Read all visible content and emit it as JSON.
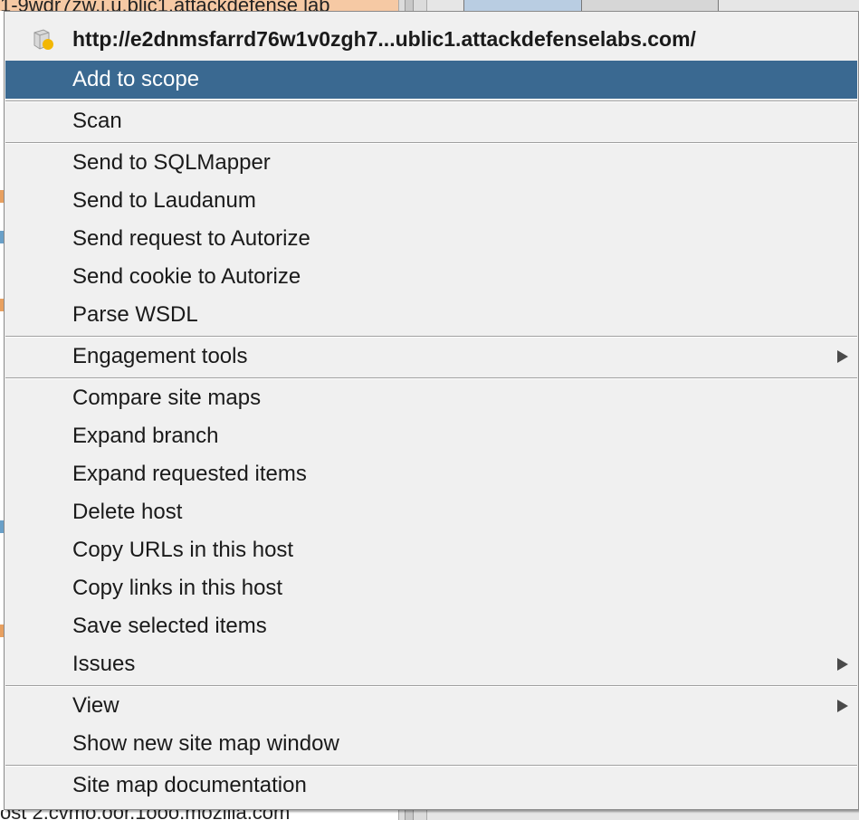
{
  "background": {
    "top_text": "1-9wdr7zw.i.u.blic1.attackdefense lab",
    "bottom_text": "ost 2.cvmo.oor.1ooo.mozilla.com"
  },
  "context_menu": {
    "header": {
      "icon": "host-node-icon",
      "url": "http://e2dnmsfarrd76w1v0zgh7...ublic1.attackdefenselabs.com/"
    },
    "items": [
      {
        "label": "Add to scope"
      },
      {
        "label": "Scan"
      },
      {
        "label": "Send to SQLMapper"
      },
      {
        "label": "Send to Laudanum"
      },
      {
        "label": "Send request to Autorize"
      },
      {
        "label": "Send cookie to Autorize"
      },
      {
        "label": "Parse WSDL"
      },
      {
        "label": "Engagement tools",
        "submenu_icon": "chevron-right-icon"
      },
      {
        "label": "Compare site maps"
      },
      {
        "label": "Expand branch"
      },
      {
        "label": "Expand requested items"
      },
      {
        "label": "Delete host"
      },
      {
        "label": "Copy URLs in this host"
      },
      {
        "label": "Copy links in this host"
      },
      {
        "label": "Save selected items"
      },
      {
        "label": "Issues",
        "submenu_icon": "chevron-right-icon"
      },
      {
        "label": "View",
        "submenu_icon": "chevron-right-icon"
      },
      {
        "label": "Show new site map window"
      },
      {
        "label": "Site map documentation"
      }
    ],
    "selected_item": "Add to scope",
    "colors": {
      "selection": "#3a6991",
      "menu_bg": "#f0f0f0",
      "icon_dot": "#f2b705"
    }
  }
}
